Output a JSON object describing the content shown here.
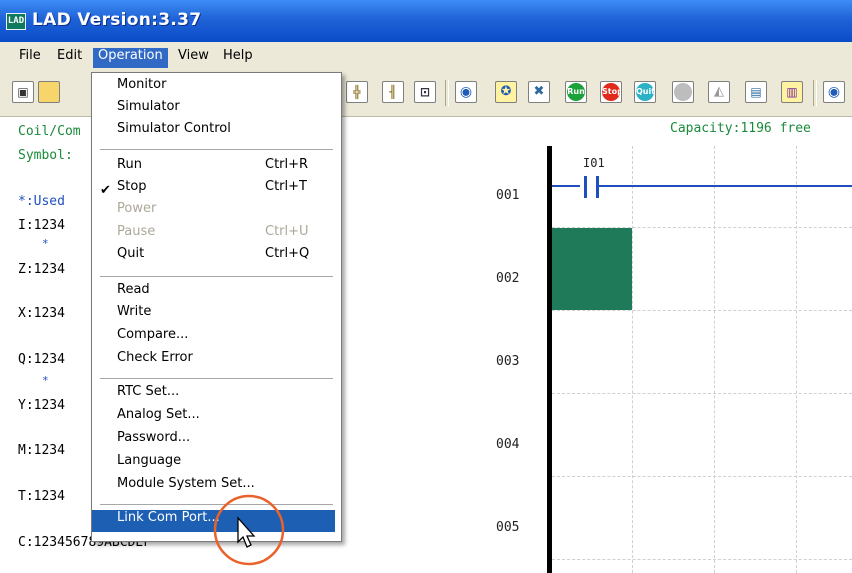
{
  "window": {
    "title": "LAD Version:3.37",
    "icon_label": "LAD"
  },
  "menubar": {
    "items": [
      "File",
      "Edit",
      "Operation",
      "View",
      "Help"
    ],
    "active": "Operation"
  },
  "toolbar": {
    "run_label": "Run",
    "stop_label": "Stop",
    "quit_label": "Quit"
  },
  "left_pane": {
    "coil": "Coil/Com",
    "symbol": "Symbol:",
    "used": "*:Used",
    "i_row": "I:1234",
    "z_row": "Z:1234",
    "x_row": "X:1234",
    "q_row": "Q:1234",
    "y_row": "Y:1234",
    "m_row": "M:1234",
    "t_row": "T:1234",
    "c_row": "C:123456789ABCDEF",
    "star": "*"
  },
  "ladder": {
    "capacity": "Capacity:1196 free",
    "rows": [
      "001",
      "002",
      "003",
      "004",
      "005"
    ],
    "contact_label": "I01",
    "colors": {
      "cursor": "#1f7a5a",
      "rail": "#000000",
      "wire": "#1f4fbf",
      "info_text": "#1a8a3a"
    }
  },
  "operation_menu": {
    "monitor": "Monitor",
    "simulator": "Simulator",
    "simulator_control": "Simulator Control",
    "run": "Run",
    "run_sc": "Ctrl+R",
    "stop": "Stop",
    "stop_sc": "Ctrl+T",
    "power": "Power",
    "pause": "Pause",
    "pause_sc": "Ctrl+U",
    "quit": "Quit",
    "quit_sc": "Ctrl+Q",
    "read": "Read",
    "write": "Write",
    "compare": "Compare...",
    "check_error": "Check Error",
    "rtc_set": "RTC Set...",
    "analog_set": "Analog Set...",
    "password": "Password...",
    "language": "Language",
    "module_system_set": "Module System Set...",
    "link_com_port": "Link Com Port...",
    "checked_item": "Stop",
    "highlighted_item": "Link Com Port..."
  }
}
